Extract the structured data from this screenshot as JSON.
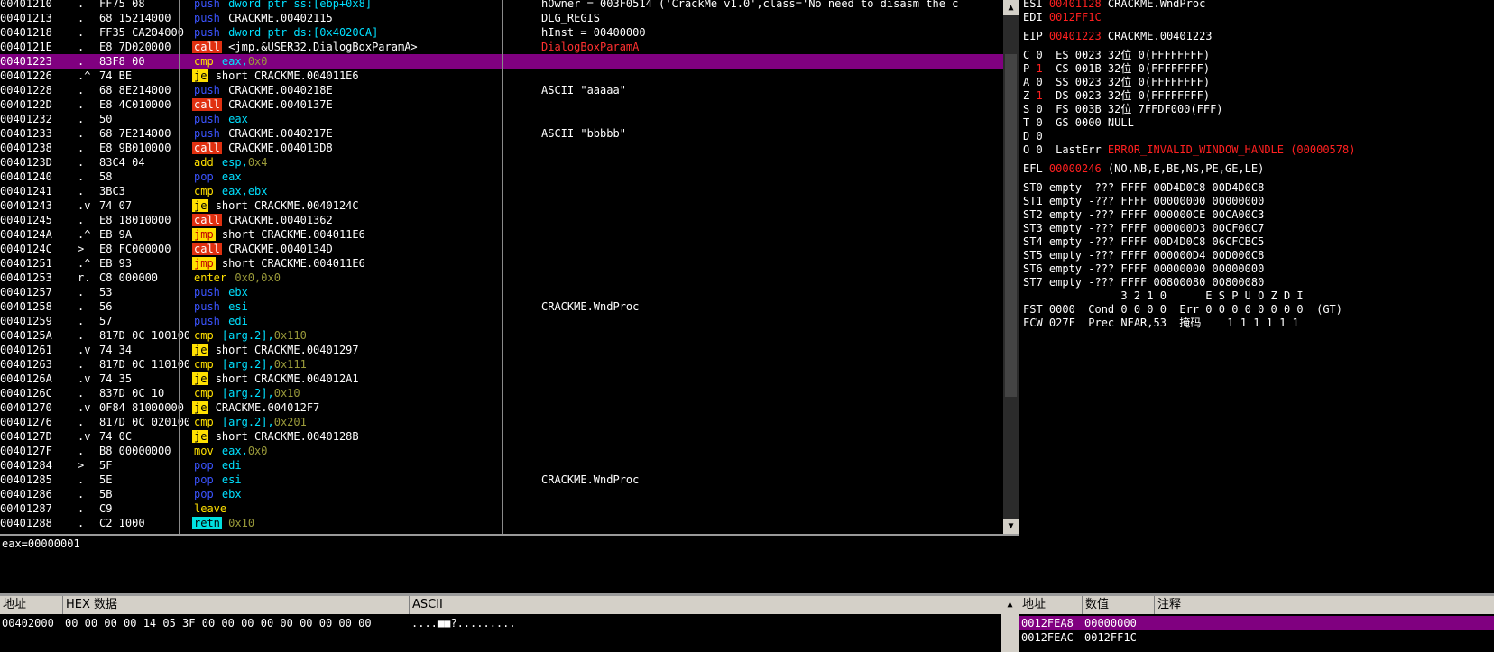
{
  "disasm": {
    "rows": [
      {
        "addr": "00401210",
        "mark": ".",
        "hex": "FF75 08",
        "mn": "push",
        "cls": "m-push",
        "ops": [
          {
            "t": "dword ptr ss:[ebp+0x8]",
            "c": "op-mem"
          }
        ],
        "cmt": "hOwner = 003F0514 ('CrackMe v1.0',class='No need to disasm the c"
      },
      {
        "addr": "00401213",
        "mark": ".",
        "hex": "68 15214000",
        "mn": "push",
        "cls": "m-push",
        "ops": [
          {
            "t": "CRACKME.00402115",
            "c": "op"
          }
        ],
        "cmt": "DLG_REGIS"
      },
      {
        "addr": "00401218",
        "mark": ".",
        "hex": "FF35 CA204000",
        "mn": "push",
        "cls": "m-push",
        "ops": [
          {
            "t": "dword ptr ds:[0x4020CA]",
            "c": "op-mem"
          }
        ],
        "cmt": "hInst = 00400000"
      },
      {
        "addr": "0040121E",
        "mark": ".",
        "hex": "E8 7D020000",
        "mn": "call",
        "cls": "m-call",
        "ops": [
          {
            "t": "<jmp.&USER32.DialogBoxParamA>",
            "c": "op"
          }
        ],
        "cmt": "DialogBoxParamA",
        "cmtRed": true
      },
      {
        "addr": "00401223",
        "mark": ".",
        "hex": "83F8 00",
        "mn": "cmp",
        "cls": "m-cmp",
        "ops": [
          {
            "t": "eax,",
            "c": "op-mem"
          },
          {
            "t": "0x0",
            "c": "op-imm"
          }
        ],
        "cmt": "",
        "sel": true
      },
      {
        "addr": "00401226",
        "mark": ".^",
        "hex": "74 BE",
        "mn": "je",
        "cls": "m-jcc",
        "ops": [
          {
            "t": "short CRACKME.004011E6",
            "c": "op"
          }
        ],
        "cmt": ""
      },
      {
        "addr": "00401228",
        "mark": ".",
        "hex": "68 8E214000",
        "mn": "push",
        "cls": "m-push",
        "ops": [
          {
            "t": "CRACKME.0040218E",
            "c": "op"
          }
        ],
        "cmt": "ASCII \"aaaaa\""
      },
      {
        "addr": "0040122D",
        "mark": ".",
        "hex": "E8 4C010000",
        "mn": "call",
        "cls": "m-call",
        "ops": [
          {
            "t": "CRACKME.0040137E",
            "c": "op"
          }
        ],
        "cmt": ""
      },
      {
        "addr": "00401232",
        "mark": ".",
        "hex": "50",
        "mn": "push",
        "cls": "m-push",
        "ops": [
          {
            "t": "eax",
            "c": "op-mem"
          }
        ],
        "cmt": ""
      },
      {
        "addr": "00401233",
        "mark": ".",
        "hex": "68 7E214000",
        "mn": "push",
        "cls": "m-push",
        "ops": [
          {
            "t": "CRACKME.0040217E",
            "c": "op"
          }
        ],
        "cmt": "ASCII \"bbbbb\""
      },
      {
        "addr": "00401238",
        "mark": ".",
        "hex": "E8 9B010000",
        "mn": "call",
        "cls": "m-call",
        "ops": [
          {
            "t": "CRACKME.004013D8",
            "c": "op"
          }
        ],
        "cmt": ""
      },
      {
        "addr": "0040123D",
        "mark": ".",
        "hex": "83C4 04",
        "mn": "add",
        "cls": "m-plain",
        "ops": [
          {
            "t": "esp,",
            "c": "op-mem"
          },
          {
            "t": "0x4",
            "c": "op-imm"
          }
        ],
        "cmt": ""
      },
      {
        "addr": "00401240",
        "mark": ".",
        "hex": "58",
        "mn": "pop",
        "cls": "m-pop",
        "ops": [
          {
            "t": "eax",
            "c": "op-mem"
          }
        ],
        "cmt": ""
      },
      {
        "addr": "00401241",
        "mark": ".",
        "hex": "3BC3",
        "mn": "cmp",
        "cls": "m-cmp",
        "ops": [
          {
            "t": "eax,ebx",
            "c": "op-mem"
          }
        ],
        "cmt": ""
      },
      {
        "addr": "00401243",
        "mark": ".v",
        "hex": "74 07",
        "mn": "je",
        "cls": "m-jcc",
        "ops": [
          {
            "t": "short CRACKME.0040124C",
            "c": "op"
          }
        ],
        "cmt": ""
      },
      {
        "addr": "00401245",
        "mark": ".",
        "hex": "E8 18010000",
        "mn": "call",
        "cls": "m-call",
        "ops": [
          {
            "t": "CRACKME.00401362",
            "c": "op"
          }
        ],
        "cmt": ""
      },
      {
        "addr": "0040124A",
        "mark": ".^",
        "hex": "EB 9A",
        "mn": "jmp",
        "cls": "m-jmp",
        "ops": [
          {
            "t": "short CRACKME.004011E6",
            "c": "op"
          }
        ],
        "cmt": ""
      },
      {
        "addr": "0040124C",
        "mark": ">",
        "hex": "E8 FC000000",
        "mn": "call",
        "cls": "m-call",
        "ops": [
          {
            "t": "CRACKME.0040134D",
            "c": "op"
          }
        ],
        "cmt": ""
      },
      {
        "addr": "00401251",
        "mark": ".^",
        "hex": "EB 93",
        "mn": "jmp",
        "cls": "m-jmp",
        "ops": [
          {
            "t": "short CRACKME.004011E6",
            "c": "op"
          }
        ],
        "cmt": ""
      },
      {
        "addr": "00401253",
        "mark": "r.",
        "hex": "C8 000000",
        "mn": "enter",
        "cls": "m-plain",
        "ops": [
          {
            "t": "0x0,0x0",
            "c": "op-imm"
          }
        ],
        "cmt": ""
      },
      {
        "addr": "00401257",
        "mark": ".",
        "hex": "53",
        "mn": "push",
        "cls": "m-push",
        "ops": [
          {
            "t": "ebx",
            "c": "op-mem"
          }
        ],
        "cmt": ""
      },
      {
        "addr": "00401258",
        "mark": ".",
        "hex": "56",
        "mn": "push",
        "cls": "m-push",
        "ops": [
          {
            "t": "esi",
            "c": "op-mem"
          }
        ],
        "cmt": "CRACKME.WndProc"
      },
      {
        "addr": "00401259",
        "mark": ".",
        "hex": "57",
        "mn": "push",
        "cls": "m-push",
        "ops": [
          {
            "t": "edi",
            "c": "op-mem"
          }
        ],
        "cmt": ""
      },
      {
        "addr": "0040125A",
        "mark": ".",
        "hex": "817D 0C 10010000",
        "mn": "cmp",
        "cls": "m-cmp",
        "ops": [
          {
            "t": "[arg.2],",
            "c": "op-mem"
          },
          {
            "t": "0x110",
            "c": "op-imm"
          }
        ],
        "cmt": ""
      },
      {
        "addr": "00401261",
        "mark": ".v",
        "hex": "74 34",
        "mn": "je",
        "cls": "m-jcc",
        "ops": [
          {
            "t": "short CRACKME.00401297",
            "c": "op"
          }
        ],
        "cmt": ""
      },
      {
        "addr": "00401263",
        "mark": ".",
        "hex": "817D 0C 11010000",
        "mn": "cmp",
        "cls": "m-cmp",
        "ops": [
          {
            "t": "[arg.2],",
            "c": "op-mem"
          },
          {
            "t": "0x111",
            "c": "op-imm"
          }
        ],
        "cmt": ""
      },
      {
        "addr": "0040126A",
        "mark": ".v",
        "hex": "74 35",
        "mn": "je",
        "cls": "m-jcc",
        "ops": [
          {
            "t": "short CRACKME.004012A1",
            "c": "op"
          }
        ],
        "cmt": ""
      },
      {
        "addr": "0040126C",
        "mark": ".",
        "hex": "837D 0C 10",
        "mn": "cmp",
        "cls": "m-cmp",
        "ops": [
          {
            "t": "[arg.2],",
            "c": "op-mem"
          },
          {
            "t": "0x10",
            "c": "op-imm"
          }
        ],
        "cmt": ""
      },
      {
        "addr": "00401270",
        "mark": ".v",
        "hex": "0F84 81000000",
        "mn": "je",
        "cls": "m-jcc",
        "ops": [
          {
            "t": "CRACKME.004012F7",
            "c": "op"
          }
        ],
        "cmt": ""
      },
      {
        "addr": "00401276",
        "mark": ".",
        "hex": "817D 0C 02010000",
        "mn": "cmp",
        "cls": "m-cmp",
        "ops": [
          {
            "t": "[arg.2],",
            "c": "op-mem"
          },
          {
            "t": "0x201",
            "c": "op-imm"
          }
        ],
        "cmt": ""
      },
      {
        "addr": "0040127D",
        "mark": ".v",
        "hex": "74 0C",
        "mn": "je",
        "cls": "m-jcc",
        "ops": [
          {
            "t": "short CRACKME.0040128B",
            "c": "op"
          }
        ],
        "cmt": ""
      },
      {
        "addr": "0040127F",
        "mark": ".",
        "hex": "B8 00000000",
        "mn": "mov",
        "cls": "m-plain",
        "ops": [
          {
            "t": "eax,",
            "c": "op-mem"
          },
          {
            "t": "0x0",
            "c": "op-imm"
          }
        ],
        "cmt": ""
      },
      {
        "addr": "00401284",
        "mark": ">",
        "hex": "5F",
        "mn": "pop",
        "cls": "m-pop",
        "ops": [
          {
            "t": "edi",
            "c": "op-mem"
          }
        ],
        "cmt": ""
      },
      {
        "addr": "00401285",
        "mark": ".",
        "hex": "5E",
        "mn": "pop",
        "cls": "m-pop",
        "ops": [
          {
            "t": "esi",
            "c": "op-mem"
          }
        ],
        "cmt": "CRACKME.WndProc"
      },
      {
        "addr": "00401286",
        "mark": ".",
        "hex": "5B",
        "mn": "pop",
        "cls": "m-pop",
        "ops": [
          {
            "t": "ebx",
            "c": "op-mem"
          }
        ],
        "cmt": ""
      },
      {
        "addr": "00401287",
        "mark": ".",
        "hex": "C9",
        "mn": "leave",
        "cls": "m-plain",
        "ops": [],
        "cmt": ""
      },
      {
        "addr": "00401288",
        "mark": ".",
        "hex": "C2 1000",
        "mn": "retn",
        "cls": "m-retn",
        "ops": [
          {
            "t": "0x10",
            "c": "op-imm"
          }
        ],
        "cmt": ""
      }
    ]
  },
  "info": {
    "line": "eax=00000001"
  },
  "registers": {
    "lines": [
      [
        {
          "t": "ESI "
        },
        {
          "t": "00401128",
          "red": true
        },
        {
          "t": " CRACKME.WndProc"
        }
      ],
      [
        {
          "t": "EDI "
        },
        {
          "t": "0012FF1C",
          "red": true
        }
      ],
      [],
      [
        {
          "t": "EIP "
        },
        {
          "t": "00401223",
          "red": true
        },
        {
          "t": " CRACKME.00401223"
        }
      ],
      [],
      [
        {
          "t": "C 0  ES 0023 32位 0(FFFFFFFF)"
        }
      ],
      [
        {
          "t": "P "
        },
        {
          "t": "1",
          "red": true
        },
        {
          "t": "  CS 001B 32位 0(FFFFFFFF)"
        }
      ],
      [
        {
          "t": "A 0  SS 0023 32位 0(FFFFFFFF)"
        }
      ],
      [
        {
          "t": "Z "
        },
        {
          "t": "1",
          "red": true
        },
        {
          "t": "  DS 0023 32位 0(FFFFFFFF)"
        }
      ],
      [
        {
          "t": "S 0  FS 003B 32位 7FFDF000(FFF)"
        }
      ],
      [
        {
          "t": "T 0  GS 0000 NULL"
        }
      ],
      [
        {
          "t": "D 0"
        }
      ],
      [
        {
          "t": "O 0  LastErr "
        },
        {
          "t": "ERROR_INVALID_WINDOW_HANDLE (00000578)",
          "red": true
        }
      ],
      [],
      [
        {
          "t": "EFL "
        },
        {
          "t": "00000246",
          "red": true
        },
        {
          "t": " (NO,NB,E,BE,NS,PE,GE,LE)"
        }
      ],
      [],
      [
        {
          "t": "ST0 empty -??? FFFF 00D4D0C8 00D4D0C8"
        }
      ],
      [
        {
          "t": "ST1 empty -??? FFFF 00000000 00000000"
        }
      ],
      [
        {
          "t": "ST2 empty -??? FFFF 000000CE 00CA00C3"
        }
      ],
      [
        {
          "t": "ST3 empty -??? FFFF 000000D3 00CF00C7"
        }
      ],
      [
        {
          "t": "ST4 empty -??? FFFF 00D4D0C8 06CFCBC5"
        }
      ],
      [
        {
          "t": "ST5 empty -??? FFFF 000000D4 00D000C8"
        }
      ],
      [
        {
          "t": "ST6 empty -??? FFFF 00000000 00000000"
        }
      ],
      [
        {
          "t": "ST7 empty -??? FFFF 00800080 00800080"
        }
      ],
      [
        {
          "t": "               3 2 1 0      E S P U O Z D I"
        }
      ],
      [
        {
          "t": "FST 0000  Cond 0 0 0 0  Err 0 0 0 0 0 0 0 0  (GT)"
        }
      ],
      [
        {
          "t": "FCW 027F  Prec NEAR,53  掩码    1 1 1 1 1 1"
        }
      ]
    ]
  },
  "dump": {
    "headers": {
      "addr": "地址",
      "hex": "HEX 数据",
      "ascii": "ASCII"
    },
    "rows": [
      {
        "addr": "00402000",
        "hex": "00 00 00 00 14 05 3F 00 00 00 00 00 00 00 00 00",
        "ascii": "....■■?........."
      }
    ]
  },
  "stack": {
    "headers": {
      "addr": "地址",
      "value": "数值",
      "comment": "注释"
    },
    "rows": [
      {
        "addr": "0012FEA8",
        "value": "00000000",
        "comment": "",
        "sel": true
      },
      {
        "addr": "0012FEAC",
        "value": "0012FF1C",
        "comment": ""
      }
    ]
  }
}
